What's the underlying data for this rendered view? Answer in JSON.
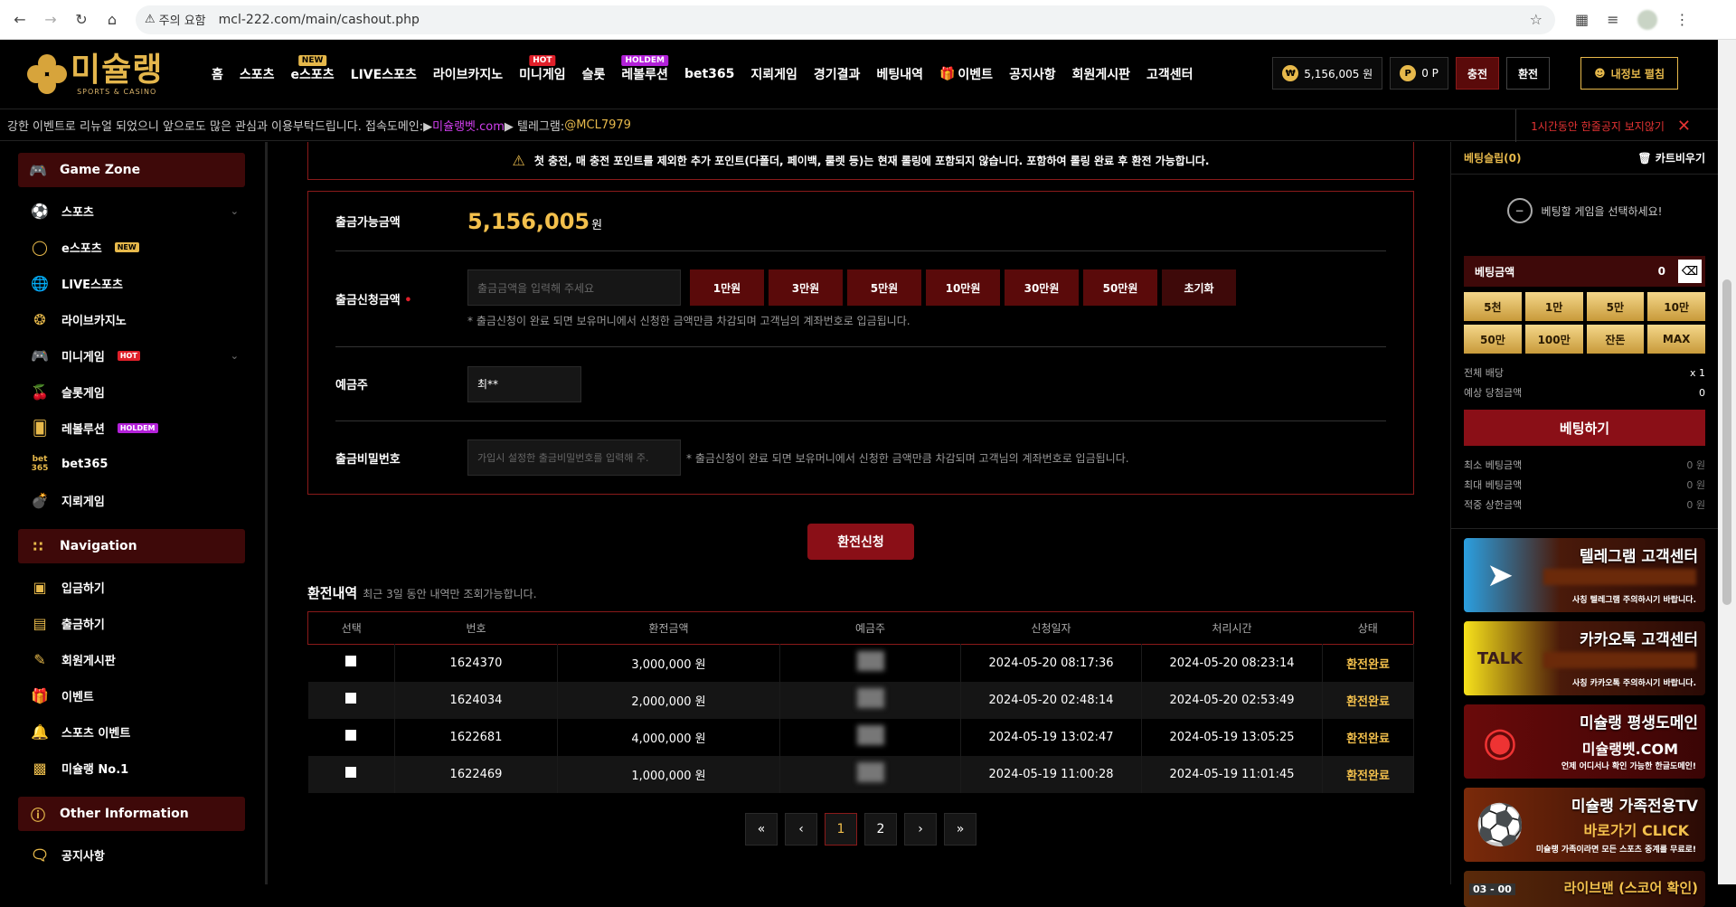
{
  "browser": {
    "warning_label": "주의 요함",
    "url": "mcl-222.com/main/cashout.php"
  },
  "logo": {
    "title": "미슐랭",
    "subtitle": "SPORTS & CASINO"
  },
  "menu": [
    {
      "label": "홈",
      "badge": ""
    },
    {
      "label": "스포츠",
      "badge": ""
    },
    {
      "label": "e스포츠",
      "badge": "NEW"
    },
    {
      "label": "LIVE스포츠",
      "badge": ""
    },
    {
      "label": "라이브카지노",
      "badge": ""
    },
    {
      "label": "미니게임",
      "badge": "HOT"
    },
    {
      "label": "슬롯",
      "badge": ""
    },
    {
      "label": "레볼루션",
      "badge": "HOLDEM"
    },
    {
      "label": "bet365",
      "badge": ""
    },
    {
      "label": "지뢰게임",
      "badge": ""
    },
    {
      "label": "경기결과",
      "badge": ""
    },
    {
      "label": "베팅내역",
      "badge": ""
    },
    {
      "label": "이벤트",
      "badge": ""
    },
    {
      "label": "공지사항",
      "badge": ""
    },
    {
      "label": "회원게시판",
      "badge": ""
    },
    {
      "label": "고객센터",
      "badge": ""
    }
  ],
  "account": {
    "money": "5,156,005 원",
    "points": "0 P",
    "deposit_btn": "충전",
    "withdraw_btn": "환전",
    "myinfo_btn": "내정보 펼침"
  },
  "ticker": {
    "text_before": "강한 이벤트로 리뉴얼 되었으니 앞으로도 많은 관심과 이용부탁드립니다. 접속도메인:▶",
    "domain": "미슐랭벳.com",
    "text_mid": " ▶ 텔레그램:",
    "telegram": "@MCL7979",
    "hide_notice": "1시간동안 한줄공지 보지않기"
  },
  "sidebar": {
    "groups": [
      {
        "title": "Game Zone",
        "items": [
          {
            "label": "스포츠",
            "badge": "",
            "chevron": true
          },
          {
            "label": "e스포츠",
            "badge": "NEW",
            "chevron": false
          },
          {
            "label": "LIVE스포츠",
            "badge": "",
            "chevron": false
          },
          {
            "label": "라이브카지노",
            "badge": "",
            "chevron": false
          },
          {
            "label": "미니게임",
            "badge": "HOT",
            "chevron": true
          },
          {
            "label": "슬롯게임",
            "badge": "",
            "chevron": false
          },
          {
            "label": "레볼루션",
            "badge": "HOLDEM",
            "chevron": false
          },
          {
            "label": "bet365",
            "badge": "",
            "chevron": false
          },
          {
            "label": "지뢰게임",
            "badge": "",
            "chevron": false
          }
        ]
      },
      {
        "title": "Navigation",
        "items": [
          {
            "label": "입금하기"
          },
          {
            "label": "출금하기"
          },
          {
            "label": "회원게시판"
          },
          {
            "label": "이벤트"
          },
          {
            "label": "스포츠 이벤트"
          },
          {
            "label": "미슐랭 No.1"
          }
        ]
      },
      {
        "title": "Other Information",
        "items": [
          {
            "label": "공지사항"
          }
        ]
      }
    ]
  },
  "notice": "첫 충전, 매 충전 포인트를 제외한 추가 포인트(다폴더, 페이백, 룰렛 등)는 현재 롤링에 포함되지 않습니다. 포함하여 롤링 완료 후 환전 가능합니다.",
  "form": {
    "available_label": "출금가능금액",
    "available_amount": "5,156,005",
    "available_unit": "원",
    "request_label": "출금신청금액",
    "request_placeholder": "출금금액을 입력해 주세요",
    "quick_buttons": [
      "1만원",
      "3만원",
      "5만원",
      "10만원",
      "30만원",
      "50만원",
      "초기화"
    ],
    "request_hint": "* 출금신청이 완료 되면 보유머니에서 신청한 금액만큼 차감되며 고객님의 계좌번호로 입금됩니다.",
    "holder_label": "예금주",
    "holder_value": "최**",
    "password_label": "출금비밀번호",
    "password_placeholder": "가입시 설정한 출금비밀번호를 입력해 주.",
    "password_hint": "* 출금신청이 완료 되면 보유머니에서 신청한 금액만큼 차감되며 고객님의 계좌번호로 입금됩니다.",
    "submit": "환전신청"
  },
  "history": {
    "title": "환전내역",
    "subtitle": "최근 3일 동안 내역만 조회가능합니다.",
    "columns": [
      "선택",
      "번호",
      "환전금액",
      "예금주",
      "신청일자",
      "처리시간",
      "상태"
    ],
    "rows": [
      {
        "no": "1624370",
        "amount": "3,000,000 원",
        "req": "2024-05-20 08:17:36",
        "done": "2024-05-20 08:23:14",
        "status": "환전완료"
      },
      {
        "no": "1624034",
        "amount": "2,000,000 원",
        "req": "2024-05-20 02:48:14",
        "done": "2024-05-20 02:53:49",
        "status": "환전완료"
      },
      {
        "no": "1622681",
        "amount": "4,000,000 원",
        "req": "2024-05-19 13:02:47",
        "done": "2024-05-19 13:05:25",
        "status": "환전완료"
      },
      {
        "no": "1622469",
        "amount": "1,000,000 원",
        "req": "2024-05-19 11:00:28",
        "done": "2024-05-19 11:01:45",
        "status": "환전완료"
      }
    ],
    "pages": [
      "1",
      "2"
    ],
    "current_page": "1"
  },
  "betslip": {
    "title": "베팅슬립(0)",
    "clear": "카트비우기",
    "empty": "베팅할 게임을 선택하세요!",
    "amount_label": "베팅금액",
    "amount_value": "0",
    "chips": [
      "5천",
      "1만",
      "5만",
      "10만",
      "50만",
      "100만",
      "잔돈",
      "MAX"
    ],
    "total_odds_label": "전체 배당",
    "total_odds": "x 1",
    "expected_label": "예상 당첨금액",
    "expected": "0",
    "bet_button": "베팅하기",
    "min_label": "최소 베팅금액",
    "min": "0 원",
    "max_label": "최대 베팅금액",
    "max": "0 원",
    "cap_label": "적중 상한금액",
    "cap": "0 원"
  },
  "banners": [
    {
      "title": "텔레그램 고객센터",
      "sub": "사칭 텔레그램 주의하시기 바랍니다."
    },
    {
      "title": "카카오톡 고객센터",
      "sub": "사칭 카카오톡 주의하시기 바랍니다.",
      "icon_text": "TALK"
    },
    {
      "title": "미슐랭 평생도메인",
      "sub": "언제 어디서나 확인 가능한 한글도메인!",
      "mid": "미슐랭벳.COM"
    },
    {
      "title": "미슐랭 가족전용TV",
      "sub": "미슐랭 가족이라면 모든 스포츠 중계를 무료로!",
      "mid": "바로가기 CLICK"
    },
    {
      "title": "라이브맨 (스코어 확인)",
      "score": "03 - 00"
    }
  ]
}
